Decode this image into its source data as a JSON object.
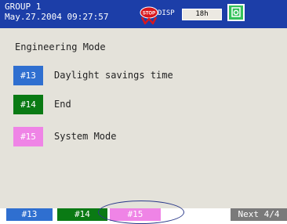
{
  "header": {
    "group": "GROUP 1",
    "datetime": "May.27.2004 09:27:57",
    "stop_icon_text": "STOP",
    "disp_label": "DISP",
    "interval": "18h"
  },
  "main": {
    "title": "Engineering Mode",
    "items": [
      {
        "badge": "#13",
        "label": "Daylight savings time",
        "color": "#2f6fd0"
      },
      {
        "badge": "#14",
        "label": "End",
        "color": "#0a7a14"
      },
      {
        "badge": "#15",
        "label": "System Mode",
        "color": "#ef84e6"
      }
    ]
  },
  "softkeys": [
    {
      "label": "#13",
      "color": "#2f6fd0"
    },
    {
      "label": "#14",
      "color": "#0a7a14"
    },
    {
      "label": "#15",
      "color": "#ef84e6"
    },
    {
      "label": "Next 4/4",
      "color": "#7a7a7a"
    }
  ],
  "colors": {
    "header_bg": "#1c3ea8",
    "panel_bg": "#e4e2da",
    "stop_icon": "#d8161d",
    "camera_icon": "#34c25a"
  }
}
